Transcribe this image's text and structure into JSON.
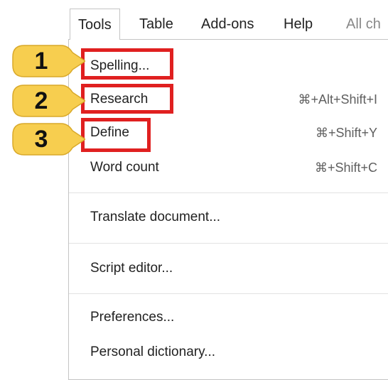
{
  "menubar": {
    "items": [
      {
        "label": "Tools"
      },
      {
        "label": "Table"
      },
      {
        "label": "Add-ons"
      },
      {
        "label": "Help"
      },
      {
        "label": "All ch"
      }
    ]
  },
  "tools_menu": {
    "items": [
      {
        "label": "Spelling...",
        "shortcut": ""
      },
      {
        "label": "Research",
        "shortcut": "⌘+Alt+Shift+I"
      },
      {
        "label": "Define",
        "shortcut": "⌘+Shift+Y"
      },
      {
        "label": "Word count",
        "shortcut": "⌘+Shift+C"
      },
      {
        "label": "Translate document...",
        "shortcut": ""
      },
      {
        "label": "Script editor...",
        "shortcut": ""
      },
      {
        "label": "Preferences...",
        "shortcut": ""
      },
      {
        "label": "Personal dictionary...",
        "shortcut": ""
      }
    ]
  },
  "callouts": [
    {
      "number": "1"
    },
    {
      "number": "2"
    },
    {
      "number": "3"
    }
  ],
  "colors": {
    "callout_fill": "#f7ce4f",
    "highlight_border": "#e02020",
    "menu_border": "#c4c4c4"
  }
}
